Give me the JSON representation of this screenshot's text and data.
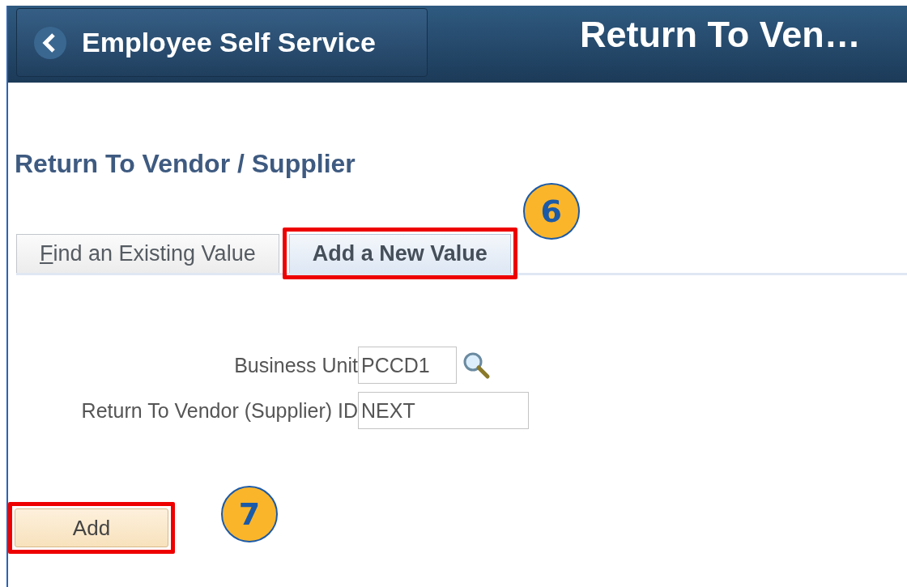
{
  "header": {
    "back_label": "Employee Self Service",
    "title": "Return To Ven…"
  },
  "page_title": "Return To Vendor / Supplier",
  "tabs": [
    {
      "label": "Find an Existing Value",
      "first_letter_underlined": true,
      "selected": false,
      "highlighted": false
    },
    {
      "label": "Add a New Value",
      "selected": true,
      "highlighted": true,
      "callout": "6"
    }
  ],
  "fields": [
    {
      "label": "Business Unit",
      "value": "PCCD1",
      "kind": "lookup"
    },
    {
      "label": "Return To Vendor (Supplier) ID",
      "value": "NEXT",
      "kind": "text"
    }
  ],
  "add_button": {
    "label": "Add",
    "highlighted": true,
    "callout": "7"
  }
}
